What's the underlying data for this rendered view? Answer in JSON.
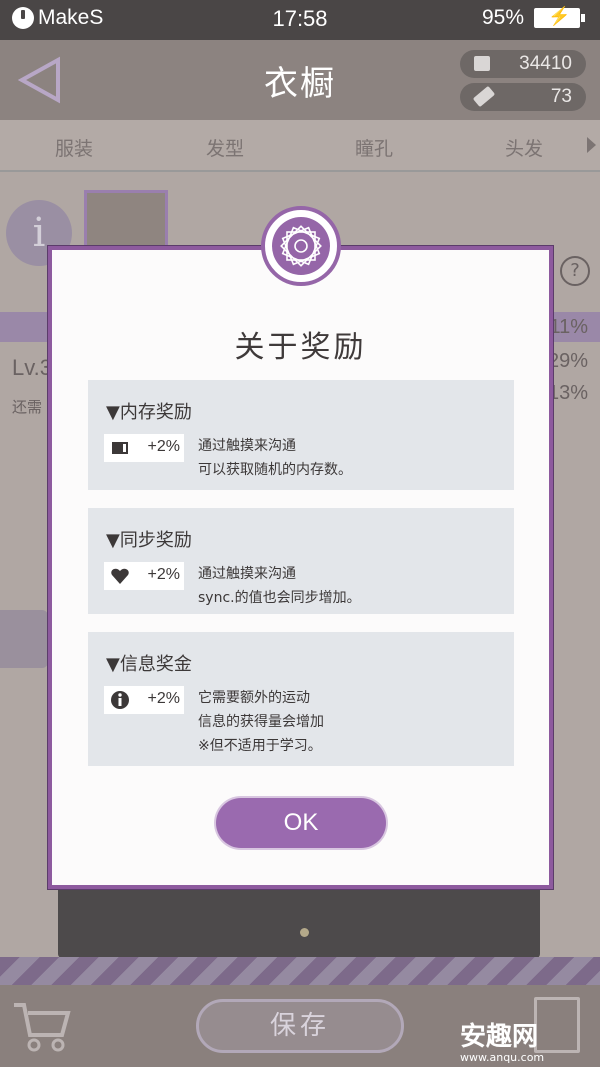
{
  "status_bar": {
    "app_name": "MakeS",
    "time": "17:58",
    "battery": "95%"
  },
  "header": {
    "title": "衣橱",
    "coins": "34410",
    "tickets": "73"
  },
  "tabs": [
    "服装",
    "发型",
    "瞳孔",
    "头发"
  ],
  "background": {
    "level": "Lv.3",
    "remaining": "还需",
    "percentages": [
      "11%",
      "29%",
      "13%"
    ]
  },
  "dialog": {
    "title": "关于奖励",
    "sections": [
      {
        "heading": "▼内存奖励",
        "icon": "memory-icon",
        "bonus": "+2%",
        "lines": [
          "通过触摸来沟通",
          "可以获取随机的内存数。"
        ]
      },
      {
        "heading": "▼同步奖励",
        "icon": "heart-icon",
        "bonus": "+2%",
        "lines": [
          "通过触摸来沟通",
          "sync.的值也会同步增加。"
        ]
      },
      {
        "heading": "▼信息奖金",
        "icon": "info-icon",
        "bonus": "+2%",
        "lines": [
          "它需要额外的运动",
          "信息的获得量会增加",
          "※但不适用于学习。"
        ]
      }
    ],
    "ok_label": "OK"
  },
  "bottom": {
    "save_label": "保存"
  },
  "watermark": {
    "name": "安趣网",
    "url": "www.anqu.com"
  },
  "colors": {
    "accent": "#9a6aaf",
    "header": "#8c8380",
    "statusbar": "#4a4646"
  }
}
